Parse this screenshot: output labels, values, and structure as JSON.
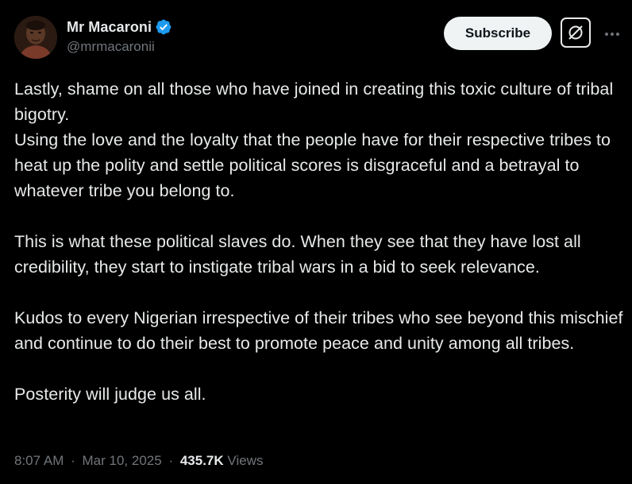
{
  "author": {
    "display_name": "Mr Macaroni",
    "handle": "@mrmacaronii",
    "verified": true
  },
  "header": {
    "subscribe_label": "Subscribe",
    "grok_icon": "grok-icon",
    "more_icon": "more-icon"
  },
  "post": {
    "lines": [
      "Lastly, shame on all those who have joined in creating this toxic culture of tribal bigotry.",
      "Using the love and the loyalty that the people have for their respective tribes to heat up the polity and settle political scores is disgraceful and a betrayal to whatever tribe you belong to.",
      "This is what these political slaves do. When they see that they have lost all credibility, they start to instigate tribal wars in a bid to seek relevance.",
      "Kudos to every Nigerian irrespective of their tribes who see beyond this mischief and continue to do their best to promote peace and unity among all tribes.",
      "Posterity will judge us all."
    ]
  },
  "meta": {
    "time": "8:07 AM",
    "separator": "·",
    "date": "Mar 10, 2025",
    "views_count": "435.7K",
    "views_label": "Views"
  },
  "colors": {
    "background": "#000000",
    "text": "#e7e9ea",
    "secondary": "#71767b",
    "verified_blue": "#1d9bf0",
    "button_bg": "#eff3f4"
  }
}
